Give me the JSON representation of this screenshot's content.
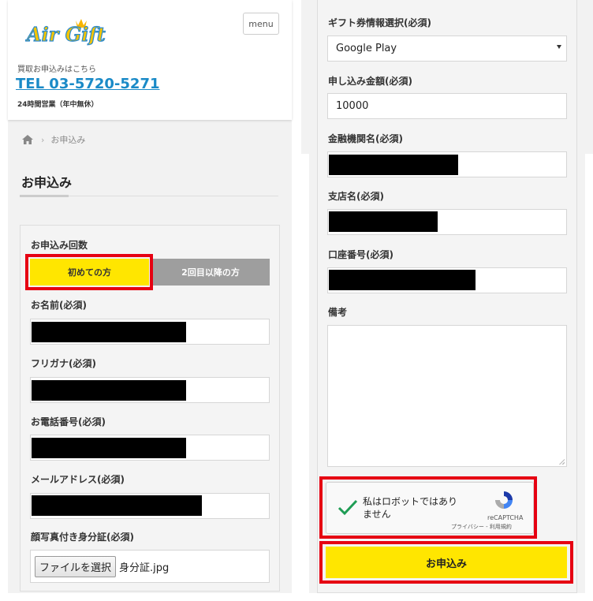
{
  "header": {
    "logo_text": "Air Gift",
    "menu_label": "menu",
    "tagline": "買取お申込みはこちら",
    "tel": "TEL 03-5720-5271",
    "hours": "24時間営業（年中無休）"
  },
  "breadcrumb": {
    "current": "お申込み"
  },
  "page_title": "お申込み",
  "form": {
    "count_label": "お申込み回数",
    "first_time": "初めての方",
    "repeat": "2回目以降の方",
    "name_label": "お名前(必須)",
    "kana_label": "フリガナ(必須)",
    "phone_label": "お電話番号(必須)",
    "email_label": "メールアドレス(必須)",
    "id_label": "顔写真付き身分証(必須)",
    "file_button": "ファイルを選択",
    "file_name": "身分証.jpg",
    "gift_label": "ギフト券情報選択(必須)",
    "gift_value": "Google Play",
    "amount_label": "申し込み金額(必須)",
    "amount_value": "10000",
    "bank_label": "金融機関名(必須)",
    "branch_label": "支店名(必須)",
    "account_label": "口座番号(必須)",
    "notes_label": "備考",
    "recaptcha_text": "私はロボットではありません",
    "recaptcha_brand": "reCAPTCHA",
    "recaptcha_links": "プライバシー - 利用規約",
    "submit_label": "お申込み"
  },
  "colors": {
    "accent_yellow": "#ffe600",
    "highlight_red": "#e60012",
    "tel_blue": "#1a8ac7",
    "gray_button": "#9e9e9e"
  }
}
